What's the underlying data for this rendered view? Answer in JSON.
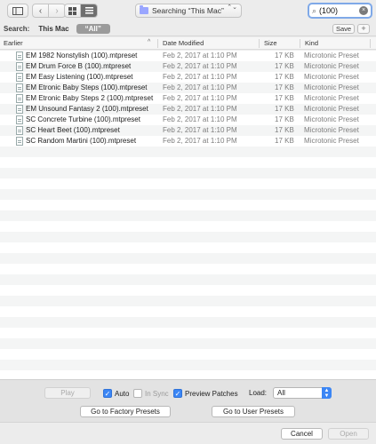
{
  "toolbar": {
    "location": "Searching “This Mac”",
    "search_value": "(100)",
    "back_glyph": "‹",
    "forward_glyph": "›",
    "updown_glyph": "⌃⌄",
    "mag_glyph": "⌕",
    "clear_glyph": "×"
  },
  "scopebar": {
    "label": "Search:",
    "scopes": [
      "This Mac",
      "“All”"
    ],
    "save_label": "Save",
    "plus_label": "+"
  },
  "table": {
    "columns": [
      "Earlier",
      "Date Modified",
      "Size",
      "Kind"
    ],
    "rows": [
      {
        "name": "EM 1982 Nonstylish (100).mtpreset",
        "date": "Feb 2, 2017 at 1:10 PM",
        "size": "17 KB",
        "kind": "Microtonic Preset"
      },
      {
        "name": "EM Drum Force B (100).mtpreset",
        "date": "Feb 2, 2017 at 1:10 PM",
        "size": "17 KB",
        "kind": "Microtonic Preset"
      },
      {
        "name": "EM Easy Listening (100).mtpreset",
        "date": "Feb 2, 2017 at 1:10 PM",
        "size": "17 KB",
        "kind": "Microtonic Preset"
      },
      {
        "name": "EM Etronic Baby Steps (100).mtpreset",
        "date": "Feb 2, 2017 at 1:10 PM",
        "size": "17 KB",
        "kind": "Microtonic Preset"
      },
      {
        "name": "EM Etronic Baby Steps 2 (100).mtpreset",
        "date": "Feb 2, 2017 at 1:10 PM",
        "size": "17 KB",
        "kind": "Microtonic Preset"
      },
      {
        "name": "EM Unsound Fantasy 2 (100).mtpreset",
        "date": "Feb 2, 2017 at 1:10 PM",
        "size": "17 KB",
        "kind": "Microtonic Preset"
      },
      {
        "name": "SC Concrete Turbine (100).mtpreset",
        "date": "Feb 2, 2017 at 1:10 PM",
        "size": "17 KB",
        "kind": "Microtonic Preset"
      },
      {
        "name": "SC Heart Beet (100).mtpreset",
        "date": "Feb 2, 2017 at 1:10 PM",
        "size": "17 KB",
        "kind": "Microtonic Preset"
      },
      {
        "name": "SC Random Martini (100).mtpreset",
        "date": "Feb 2, 2017 at 1:10 PM",
        "size": "17 KB",
        "kind": "Microtonic Preset"
      }
    ]
  },
  "accessory": {
    "play_label": "Play",
    "auto_label": "Auto",
    "auto_checked": true,
    "insync_label": "In Sync",
    "insync_checked": false,
    "preview_label": "Preview Patches",
    "preview_checked": true,
    "load_label": "Load:",
    "load_value": "All",
    "factory_label": "Go to Factory Presets",
    "user_label": "Go to User Presets"
  },
  "footer": {
    "cancel_label": "Cancel",
    "open_label": "Open"
  },
  "colors": {
    "accent": "#3b86f5",
    "search_focus": "#7fa9e8"
  }
}
